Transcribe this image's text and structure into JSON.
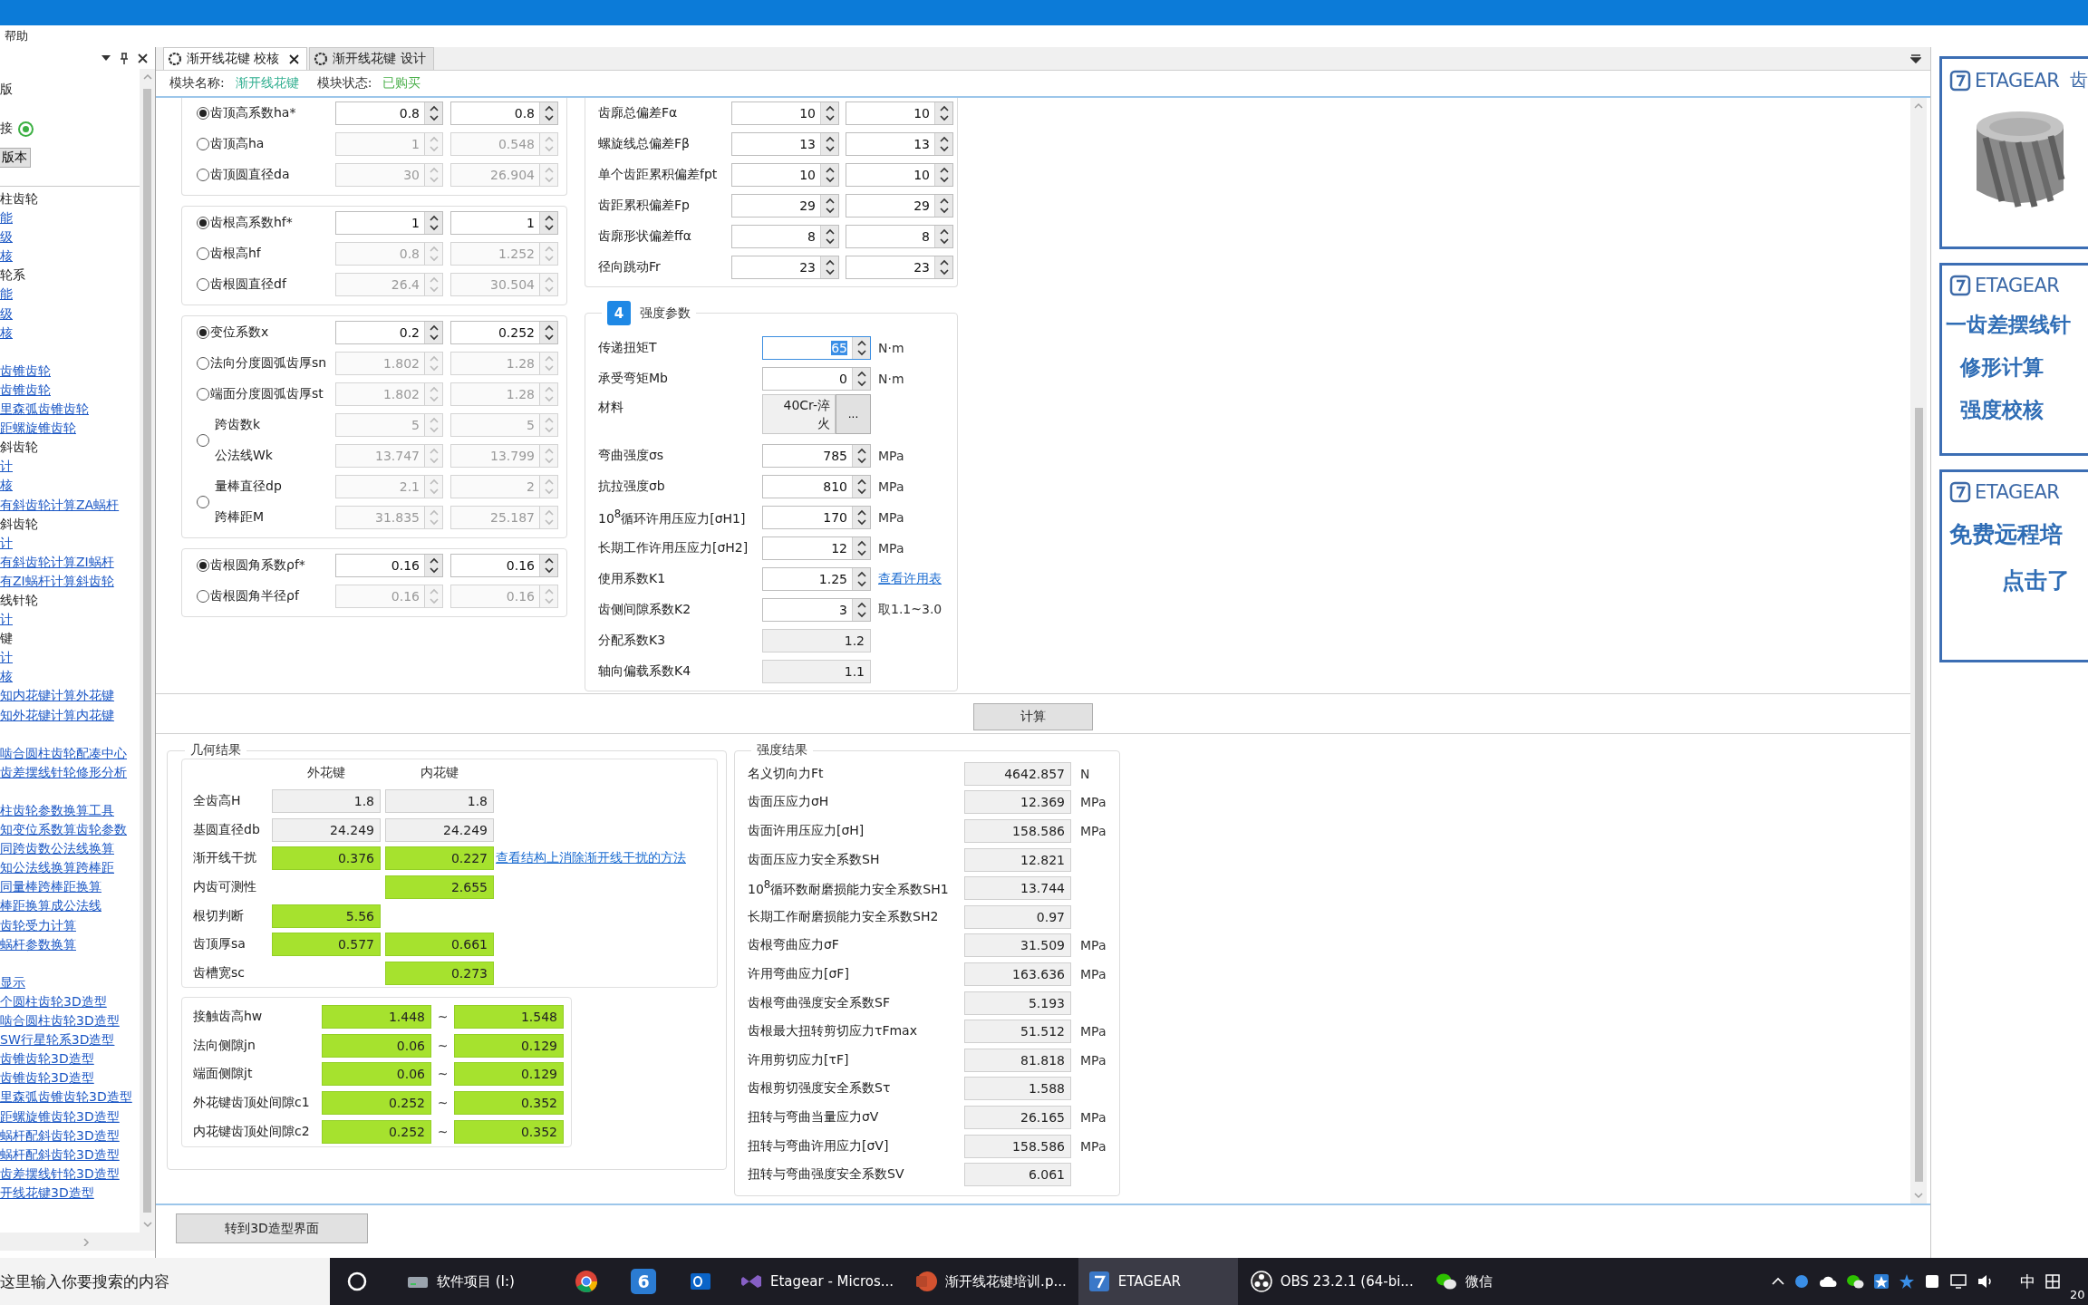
{
  "menu": [
    {
      "label": "帮助"
    }
  ],
  "sidebar": {
    "lines": [
      "版"
    ],
    "status": {
      "label": "接",
      "on": true
    },
    "button": "版本",
    "tree": [
      {
        "kind": "heading",
        "text": "柱齿轮"
      },
      {
        "kind": "link",
        "text": "能"
      },
      {
        "kind": "link",
        "text": "级"
      },
      {
        "kind": "link",
        "text": "核"
      },
      {
        "kind": "heading",
        "text": "轮系"
      },
      {
        "kind": "link",
        "text": "能"
      },
      {
        "kind": "link",
        "text": "级"
      },
      {
        "kind": "link",
        "text": "核"
      },
      {
        "kind": "gap"
      },
      {
        "kind": "link",
        "text": "齿锥齿轮"
      },
      {
        "kind": "link",
        "text": "齿锥齿轮"
      },
      {
        "kind": "link",
        "text": "里森弧齿锥齿轮"
      },
      {
        "kind": "link",
        "text": "距螺旋锥齿轮"
      },
      {
        "kind": "heading",
        "text": "斜齿轮"
      },
      {
        "kind": "link",
        "text": "计"
      },
      {
        "kind": "link",
        "text": "核"
      },
      {
        "kind": "link",
        "text": "有斜齿轮计算ZA蜗杆"
      },
      {
        "kind": "heading",
        "text": "斜齿轮"
      },
      {
        "kind": "link",
        "text": "计"
      },
      {
        "kind": "link",
        "text": "有斜齿轮计算ZI蜗杆"
      },
      {
        "kind": "link",
        "text": "有ZI蜗杆计算斜齿轮"
      },
      {
        "kind": "heading",
        "text": "线针轮"
      },
      {
        "kind": "link",
        "text": "计"
      },
      {
        "kind": "heading",
        "text": "键"
      },
      {
        "kind": "link",
        "text": "计"
      },
      {
        "kind": "link",
        "text": "核"
      },
      {
        "kind": "link",
        "text": "知内花键计算外花键"
      },
      {
        "kind": "link",
        "text": "知外花键计算内花键"
      },
      {
        "kind": "gap"
      },
      {
        "kind": "link",
        "text": "啮合圆柱齿轮配凑中心"
      },
      {
        "kind": "link",
        "text": "齿差摆线针轮修形分析"
      },
      {
        "kind": "gap"
      },
      {
        "kind": "link",
        "text": "柱齿轮参数换算工具"
      },
      {
        "kind": "link",
        "text": "知变位系数算齿轮参数"
      },
      {
        "kind": "link",
        "text": "同跨齿数公法线换算"
      },
      {
        "kind": "link",
        "text": "知公法线换算跨棒距"
      },
      {
        "kind": "link",
        "text": "同量棒跨棒距换算"
      },
      {
        "kind": "link",
        "text": "棒距换算成公法线"
      },
      {
        "kind": "link",
        "text": "齿轮受力计算"
      },
      {
        "kind": "link",
        "text": "蜗杆参数换算"
      },
      {
        "kind": "gap"
      },
      {
        "kind": "link",
        "text": "显示"
      },
      {
        "kind": "link",
        "text": "个圆柱齿轮3D造型"
      },
      {
        "kind": "link",
        "text": "啮合圆柱齿轮3D造型"
      },
      {
        "kind": "link",
        "text": "SW行星轮系3D造型"
      },
      {
        "kind": "link",
        "text": "齿锥齿轮3D造型"
      },
      {
        "kind": "link",
        "text": "齿锥齿轮3D造型"
      },
      {
        "kind": "link",
        "text": "里森弧齿锥齿轮3D造型"
      },
      {
        "kind": "link",
        "text": "距螺旋锥齿轮3D造型"
      },
      {
        "kind": "link",
        "text": "蜗杆配斜齿轮3D造型"
      },
      {
        "kind": "link",
        "text": "蜗杆配斜齿轮3D造型"
      },
      {
        "kind": "link",
        "text": "齿差摆线针轮3D造型"
      },
      {
        "kind": "link",
        "text": "开线花键3D造型"
      }
    ]
  },
  "tabs": [
    {
      "label": "渐开线花键 校核",
      "selected": true,
      "closable": true
    },
    {
      "label": "渐开线花键 设计",
      "selected": false,
      "closable": false
    }
  ],
  "module": {
    "name_label": "模块名称:",
    "name": "渐开线花键",
    "status_label": "模块状态:",
    "status": "已购买"
  },
  "left_groups": [
    {
      "rows": [
        {
          "kind": "single",
          "label": "齿顶高系数ha*",
          "selected": true,
          "values": [
            "0.8",
            "0.8"
          ]
        },
        {
          "kind": "single",
          "label": "齿顶高ha",
          "selected": false,
          "values": [
            "1",
            "0.548"
          ]
        },
        {
          "kind": "single",
          "label": "齿顶圆直径da",
          "selected": false,
          "values": [
            "30",
            "26.904"
          ]
        }
      ]
    },
    {
      "rows": [
        {
          "kind": "single",
          "label": "齿根高系数hf*",
          "selected": true,
          "values": [
            "1",
            "1"
          ]
        },
        {
          "kind": "single",
          "label": "齿根高hf",
          "selected": false,
          "values": [
            "0.8",
            "1.252"
          ]
        },
        {
          "kind": "single",
          "label": "齿根圆直径df",
          "selected": false,
          "values": [
            "26.4",
            "30.504"
          ]
        }
      ]
    },
    {
      "rows": [
        {
          "kind": "single",
          "label": "变位系数x",
          "selected": true,
          "values": [
            "0.2",
            "0.252"
          ]
        },
        {
          "kind": "single",
          "label": "法向分度圆弧齿厚sn",
          "selected": false,
          "values": [
            "1.802",
            "1.28"
          ]
        },
        {
          "kind": "single",
          "label": "端面分度圆弧齿厚st",
          "selected": false,
          "values": [
            "1.802",
            "1.28"
          ]
        },
        {
          "kind": "pair",
          "selected": false,
          "lines": [
            {
              "label": "跨齿数k",
              "values": [
                "5",
                "5"
              ]
            },
            {
              "label": "公法线Wk",
              "values": [
                "13.747",
                "13.799"
              ]
            }
          ]
        },
        {
          "kind": "pair",
          "selected": false,
          "lines": [
            {
              "label": "量棒直径dp",
              "values": [
                "2.1",
                "2"
              ]
            },
            {
              "label": "跨棒距M",
              "values": [
                "31.835",
                "25.187"
              ]
            }
          ]
        }
      ]
    },
    {
      "rows": [
        {
          "kind": "single",
          "label": "齿根圆角系数ρf*",
          "selected": true,
          "values": [
            "0.16",
            "0.16"
          ]
        },
        {
          "kind": "single",
          "label": "齿根圆角半径ρf",
          "selected": false,
          "values": [
            "0.16",
            "0.16"
          ]
        }
      ]
    }
  ],
  "tolerances": [
    {
      "label": "齿廓总偏差Fα",
      "values": [
        "10",
        "10"
      ]
    },
    {
      "label": "螺旋线总偏差Fβ",
      "values": [
        "13",
        "13"
      ]
    },
    {
      "label": "单个齿距累积偏差fpt",
      "values": [
        "10",
        "10"
      ]
    },
    {
      "label": "齿距累积偏差Fp",
      "values": [
        "29",
        "29"
      ]
    },
    {
      "label": "齿廓形状偏差ffα",
      "values": [
        "8",
        "8"
      ]
    },
    {
      "label": "径向跳动Fr",
      "values": [
        "23",
        "23"
      ]
    }
  ],
  "strength_params": {
    "badge": "4",
    "title": "强度参数",
    "rows": [
      {
        "kind": "spin",
        "label": "传递扭矩T",
        "value": "65",
        "unit": "N·m",
        "focused": true
      },
      {
        "kind": "spin",
        "label": "承受弯矩Mb",
        "value": "0",
        "unit": "N·m",
        "focused": false
      },
      {
        "kind": "picker",
        "label": "材料",
        "value": "40Cr-淬火",
        "button": "..."
      },
      {
        "kind": "spin",
        "label": "弯曲强度σs",
        "value": "785",
        "unit": "MPa",
        "focused": false
      },
      {
        "kind": "spin",
        "label": "抗拉强度σb",
        "value": "810",
        "unit": "MPa",
        "focused": false
      },
      {
        "kind": "spin",
        "label": "10$^{8}$循环许用压应力[σH1]",
        "value": "170",
        "unit": "MPa",
        "focused": false
      },
      {
        "kind": "spin",
        "label": "长期工作许用压应力[σH2]",
        "value": "12",
        "unit": "MPa",
        "focused": false
      },
      {
        "kind": "spin",
        "label": "使用系数K1",
        "value": "1.25",
        "unit": "查看许用表",
        "unit_link": true,
        "focused": false
      },
      {
        "kind": "spin",
        "label": "齿侧间隙系数K2",
        "value": "3",
        "unit": "取1.1~3.0",
        "focused": false
      },
      {
        "kind": "readonly",
        "label": "分配系数K3",
        "value": "1.2"
      },
      {
        "kind": "readonly",
        "label": "轴向偏载系数K4",
        "value": "1.1"
      }
    ]
  },
  "calc_button": "计算",
  "geometry_results": {
    "title": "几何结果",
    "columns": [
      "外花键",
      "内花键"
    ],
    "rows": [
      {
        "label": "全齿高H",
        "cells": [
          {
            "value": "1.8",
            "highlighted": false
          },
          {
            "value": "1.8",
            "highlighted": false
          }
        ]
      },
      {
        "label": "基圆直径db",
        "cells": [
          {
            "value": "24.249",
            "highlighted": false
          },
          {
            "value": "24.249",
            "highlighted": false
          }
        ]
      },
      {
        "label": "渐开线干扰",
        "cells": [
          {
            "value": "0.376",
            "highlighted": true
          },
          {
            "value": "0.227",
            "highlighted": true
          }
        ],
        "link": "查看结构上消除渐开线干扰的方法"
      },
      {
        "label": "内齿可测性",
        "cells": [
          {
            "blank": true
          },
          {
            "value": "2.655",
            "highlighted": true
          }
        ]
      },
      {
        "label": "根切判断",
        "cells": [
          {
            "value": "5.56",
            "highlighted": true
          },
          {
            "blank": true
          }
        ]
      },
      {
        "label": "齿顶厚sa",
        "cells": [
          {
            "value": "0.577",
            "highlighted": true
          },
          {
            "value": "0.661",
            "highlighted": true
          }
        ]
      },
      {
        "label": "齿槽宽sc",
        "cells": [
          {
            "blank": true
          },
          {
            "value": "0.273",
            "highlighted": true
          }
        ]
      }
    ],
    "ranges": [
      {
        "label": "接触齿高hw",
        "min": "1.448",
        "separator": "~",
        "max": "1.548",
        "highlighted": true
      },
      {
        "label": "法向侧隙jn",
        "min": "0.06",
        "separator": "~",
        "max": "0.129",
        "highlighted": true
      },
      {
        "label": "端面侧隙jt",
        "min": "0.06",
        "separator": "~",
        "max": "0.129",
        "highlighted": true
      },
      {
        "label": "外花键齿顶处间隙c1",
        "min": "0.252",
        "separator": "~",
        "max": "0.352",
        "highlighted": true
      },
      {
        "label": "内花键齿顶处间隙c2",
        "min": "0.252",
        "separator": "~",
        "max": "0.352",
        "highlighted": true
      }
    ]
  },
  "strength_results": {
    "title": "强度结果",
    "rows": [
      {
        "label": "名义切向力Ft",
        "value": "4642.857",
        "unit": "N"
      },
      {
        "label": "齿面压应力σH",
        "value": "12.369",
        "unit": "MPa"
      },
      {
        "label": "齿面许用压应力[σH]",
        "value": "158.586",
        "unit": "MPa"
      },
      {
        "label": "齿面压应力安全系数SH",
        "value": "12.821"
      },
      {
        "label": "10$^{8}$循环数耐磨损能力安全系数SH1",
        "value": "13.744"
      },
      {
        "label": "长期工作耐磨损能力安全系数SH2",
        "value": "0.97"
      },
      {
        "label": "齿根弯曲应力σF",
        "value": "31.509",
        "unit": "MPa"
      },
      {
        "label": "许用弯曲应力[σF]",
        "value": "163.636",
        "unit": "MPa"
      },
      {
        "label": "齿根弯曲强度安全系数SF",
        "value": "5.193"
      },
      {
        "label": "齿根最大扭转剪切应力τFmax",
        "value": "51.512",
        "unit": "MPa"
      },
      {
        "label": "许用剪切应力[τF]",
        "value": "81.818",
        "unit": "MPa"
      },
      {
        "label": "齿根剪切强度安全系数Sτ",
        "value": "1.588"
      },
      {
        "label": "扭转与弯曲当量应力σV",
        "value": "26.165",
        "unit": "MPa"
      },
      {
        "label": "扭转与弯曲许用应力[σV]",
        "value": "158.586",
        "unit": "MPa"
      },
      {
        "label": "扭转与弯曲强度安全系数SV",
        "value": "6.061"
      }
    ]
  },
  "bottom_button": "转到3D造型界面",
  "ads": [
    {
      "logo": "ETAGEAR",
      "heading": "齿"
    },
    {
      "kind": "text",
      "logo": "ETAGEAR",
      "lines": [
        "一齿差摆线针",
        "修形计算",
        "强度校核"
      ]
    },
    {
      "kind": "text",
      "logo": "ETAGEAR",
      "lines": [
        "免费远程培",
        "点击了"
      ]
    }
  ],
  "taskbar": {
    "search_placeholder": "这里输入你要搜索的内容",
    "apps": [
      {
        "kind": "folder",
        "label": "软件项目 (I:)",
        "active": false
      },
      {
        "kind": "chrome",
        "active": false
      },
      {
        "kind": "badge",
        "glyph": "6",
        "active": false
      },
      {
        "kind": "outlook",
        "active": false
      },
      {
        "kind": "vs",
        "label": "Etagear - Micros...",
        "active": false
      },
      {
        "kind": "ppt",
        "label": "渐开线花键培训.p...",
        "active": false
      },
      {
        "kind": "etagear",
        "label": "ETAGEAR",
        "active": true
      },
      {
        "kind": "obs",
        "label": "OBS 23.2.1 (64-bi...",
        "active": false
      },
      {
        "kind": "wechat",
        "label": "微信",
        "active": false
      }
    ],
    "ime": "中",
    "clock": "20"
  }
}
